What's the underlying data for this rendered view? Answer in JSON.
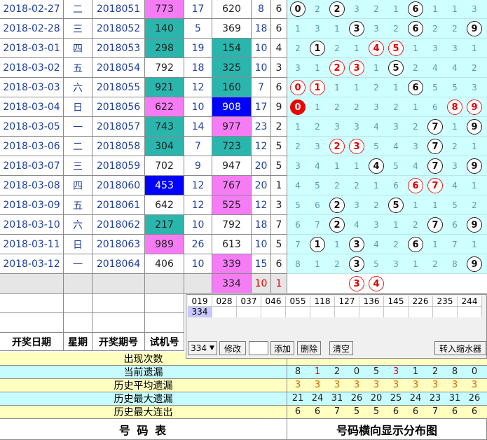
{
  "rows": [
    {
      "date": "2018-02-27",
      "weekday": "二",
      "issue": "2018051",
      "trial": "773",
      "trial_bg": "pink",
      "span": "17",
      "sum": "620",
      "sum_bg": "white",
      "v1": "8",
      "v2": "6",
      "dist": [
        "0",
        "2",
        "2",
        "3",
        "2",
        "1",
        "6",
        "1",
        "1",
        "3"
      ],
      "hits": [
        0,
        2,
        6
      ]
    },
    {
      "date": "2018-02-28",
      "weekday": "三",
      "issue": "2018052",
      "trial": "140",
      "trial_bg": "teal",
      "span": "5",
      "sum": "369",
      "sum_bg": "white",
      "v1": "18",
      "v2": "6",
      "dist": [
        "1",
        "3",
        "1",
        "3",
        "3",
        "2",
        "6",
        "2",
        "2",
        "9"
      ],
      "hits": [
        3,
        6,
        9
      ]
    },
    {
      "date": "2018-03-01",
      "weekday": "四",
      "issue": "2018053",
      "trial": "298",
      "trial_bg": "teal",
      "span": "19",
      "sum": "154",
      "sum_bg": "teal",
      "v1": "10",
      "v2": "4",
      "dist": [
        "2",
        "1",
        "2",
        "1",
        "4",
        "5",
        "1",
        "3",
        "3",
        "1"
      ],
      "hits": [
        1,
        4,
        5
      ]
    },
    {
      "date": "2018-03-02",
      "weekday": "五",
      "issue": "2018054",
      "trial": "792",
      "trial_bg": "white",
      "span": "18",
      "sum": "325",
      "sum_bg": "teal",
      "v1": "10",
      "v2": "3",
      "dist": [
        "3",
        "1",
        "2",
        "3",
        "1",
        "5",
        "2",
        "4",
        "4",
        "2"
      ],
      "hits": [
        2,
        3,
        5
      ]
    },
    {
      "date": "2018-03-03",
      "weekday": "六",
      "issue": "2018055",
      "trial": "921",
      "trial_bg": "teal",
      "span": "12",
      "sum": "160",
      "sum_bg": "teal",
      "v1": "7",
      "v2": "6",
      "dist": [
        "0",
        "1",
        "1",
        "1",
        "2",
        "1",
        "6",
        "5",
        "5",
        "3"
      ],
      "hits": [
        0,
        1,
        6
      ]
    },
    {
      "date": "2018-03-04",
      "weekday": "日",
      "issue": "2018056",
      "trial": "622",
      "trial_bg": "pink",
      "span": "10",
      "sum": "908",
      "sum_bg": "blue",
      "v1": "17",
      "v2": "9",
      "dist": [
        "0",
        "1",
        "2",
        "2",
        "3",
        "2",
        "1",
        "6",
        "8",
        "9"
      ],
      "hits": [
        0,
        8,
        9
      ]
    },
    {
      "date": "2018-03-05",
      "weekday": "一",
      "issue": "2018057",
      "trial": "743",
      "trial_bg": "teal",
      "span": "14",
      "sum": "977",
      "sum_bg": "pink",
      "v1": "23",
      "v2": "2",
      "dist": [
        "1",
        "2",
        "3",
        "3",
        "4",
        "3",
        "2",
        "7",
        "1",
        "9"
      ],
      "hits": [
        7,
        9
      ]
    },
    {
      "date": "2018-03-06",
      "weekday": "二",
      "issue": "2018058",
      "trial": "304",
      "trial_bg": "teal",
      "span": "7",
      "sum": "723",
      "sum_bg": "teal",
      "v1": "12",
      "v2": "5",
      "dist": [
        "2",
        "3",
        "2",
        "3",
        "5",
        "4",
        "3",
        "7",
        "2",
        "1"
      ],
      "hits": [
        2,
        3,
        7
      ]
    },
    {
      "date": "2018-03-07",
      "weekday": "三",
      "issue": "2018059",
      "trial": "702",
      "trial_bg": "white",
      "span": "9",
      "sum": "947",
      "sum_bg": "white",
      "v1": "20",
      "v2": "5",
      "dist": [
        "3",
        "4",
        "1",
        "1",
        "4",
        "5",
        "4",
        "7",
        "3",
        "9"
      ],
      "hits": [
        4,
        7,
        9
      ]
    },
    {
      "date": "2018-03-08",
      "weekday": "四",
      "issue": "2018060",
      "trial": "453",
      "trial_bg": "blue",
      "span": "12",
      "sum": "767",
      "sum_bg": "pink",
      "v1": "20",
      "v2": "1",
      "dist": [
        "4",
        "5",
        "2",
        "2",
        "1",
        "6",
        "6",
        "7",
        "4",
        "1"
      ],
      "hits": [
        6,
        7
      ]
    },
    {
      "date": "2018-03-09",
      "weekday": "五",
      "issue": "2018061",
      "trial": "642",
      "trial_bg": "white",
      "span": "12",
      "sum": "525",
      "sum_bg": "pink",
      "v1": "12",
      "v2": "3",
      "dist": [
        "5",
        "6",
        "2",
        "3",
        "2",
        "5",
        "1",
        "1",
        "5",
        "2"
      ],
      "hits": [
        2,
        5
      ]
    },
    {
      "date": "2018-03-10",
      "weekday": "六",
      "issue": "2018062",
      "trial": "217",
      "trial_bg": "teal",
      "span": "10",
      "sum": "792",
      "sum_bg": "white",
      "v1": "18",
      "v2": "7",
      "dist": [
        "6",
        "7",
        "2",
        "4",
        "3",
        "1",
        "2",
        "7",
        "6",
        "9"
      ],
      "hits": [
        2,
        7,
        9
      ]
    },
    {
      "date": "2018-03-11",
      "weekday": "日",
      "issue": "2018063",
      "trial": "989",
      "trial_bg": "pink",
      "span": "26",
      "sum": "613",
      "sum_bg": "white",
      "v1": "10",
      "v2": "5",
      "dist": [
        "7",
        "1",
        "1",
        "3",
        "4",
        "2",
        "6",
        "1",
        "7",
        "1"
      ],
      "hits": [
        1,
        3,
        6
      ]
    },
    {
      "date": "2018-03-12",
      "weekday": "一",
      "issue": "2018064",
      "trial": "406",
      "trial_bg": "white",
      "span": "10",
      "sum": "339",
      "sum_bg": "pink",
      "v1": "15",
      "v2": "6",
      "dist": [
        "8",
        "1",
        "2",
        "3",
        "5",
        "3",
        "1",
        "2",
        "8",
        "9"
      ],
      "hits": [
        3,
        9
      ]
    }
  ],
  "pending": {
    "sum": "334",
    "v1": "10",
    "v2": "1",
    "dist_hits": [
      "3",
      "4"
    ]
  },
  "headers": {
    "date": "开奖日期",
    "weekday": "星期",
    "issue": "开奖期号",
    "trial": "试机号"
  },
  "panel": {
    "columns": [
      "019",
      "028",
      "037",
      "046",
      "055",
      "118",
      "127",
      "136",
      "145",
      "226",
      "235",
      "244"
    ],
    "value": "334",
    "select_value": "334",
    "buttons": {
      "edit": "修改",
      "add": "添加",
      "delete": "删除",
      "clear": "清空",
      "transfer": "转入缩水器"
    }
  },
  "stats": {
    "labels": [
      "出现次数",
      "当前遗漏",
      "历史平均遗漏",
      "历史最大遗漏",
      "历史最大连出"
    ],
    "current": [
      "8",
      "1",
      "2",
      "0",
      "5",
      "3",
      "1",
      "2",
      "8",
      "0"
    ],
    "average": [
      "3",
      "3",
      "3",
      "3",
      "3",
      "3",
      "3",
      "3",
      "3",
      "3"
    ],
    "max_miss": [
      "21",
      "24",
      "31",
      "26",
      "20",
      "25",
      "24",
      "23",
      "31",
      "26"
    ],
    "max_run": [
      "6",
      "6",
      "7",
      "5",
      "5",
      "6",
      "6",
      "7",
      "6",
      "6"
    ]
  },
  "footer": {
    "left": "号   码   表",
    "right": "号码横向显示分布图"
  },
  "colors": {
    "pink": "#f67cf6",
    "teal": "#2ab5ad",
    "blue": "#0000ff",
    "dist_bg": "#cfffff",
    "yellow": "#ffffc0",
    "cyan_row": "#c7fcff"
  }
}
